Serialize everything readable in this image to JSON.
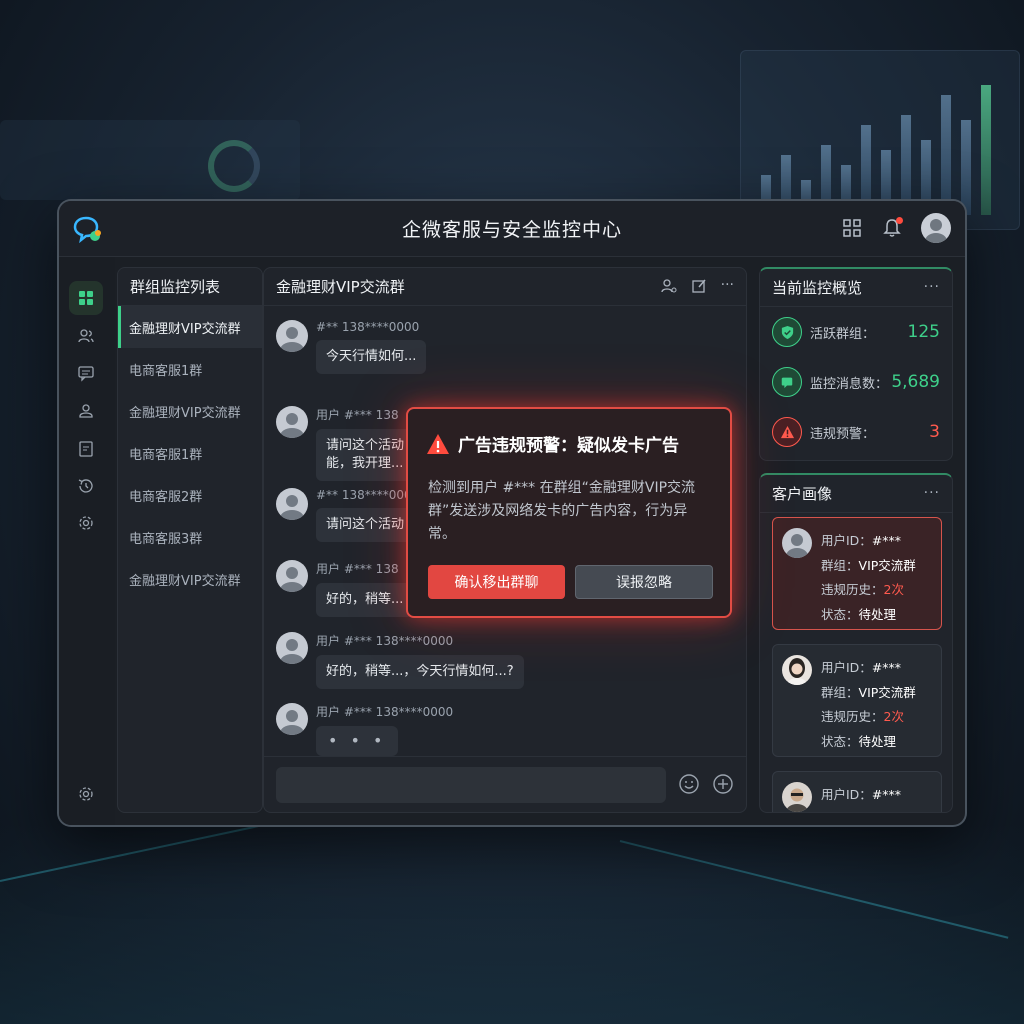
{
  "app": {
    "title": "企微客服与安全监控中心"
  },
  "groups": {
    "title": "群组监控列表",
    "items": [
      "金融理财VIP交流群",
      "电商客服1群",
      "金融理财VIP交流群",
      "电商客服1群",
      "电商客服2群",
      "电商客服3群",
      "金融理财VIP交流群"
    ]
  },
  "chat": {
    "title": "金融理财VIP交流群",
    "messages": [
      {
        "sender": "#** 138****0000",
        "text": "今天行情如何..."
      },
      {
        "sender": "用户 #*** 138",
        "text": "请问这个活动",
        "text2": "能，我开理..."
      },
      {
        "sender": "#** 138****000",
        "text": "请问这个活动"
      },
      {
        "sender": "用户 #*** 138",
        "text": "好的，稍等..."
      },
      {
        "sender": "用户 #*** 138****0000",
        "text": "好的，稍等...，今天行情如何...?"
      },
      {
        "sender": "用户 #*** 138****0000",
        "text": "• • •"
      }
    ],
    "input_placeholder": ""
  },
  "modal": {
    "title": "广告违规预警：疑似发卡广告",
    "body": "检测到用户 #*** 在群组“金融理财VIP交流群”发送涉及网络发卡的广告内容，行为异常。",
    "confirm_label": "确认移出群聊",
    "ignore_label": "误报忽略"
  },
  "overview": {
    "title": "当前监控概览",
    "more": "···",
    "rows": [
      {
        "label": "活跃群组：",
        "value": "125",
        "color": "#3ed08a"
      },
      {
        "label": "监控消息数：",
        "value": "5,689",
        "color": "#3ed08a"
      },
      {
        "label": "违规预警：",
        "value": "3",
        "color": "#ff5a4e"
      }
    ]
  },
  "portrait": {
    "title": "客户画像",
    "more": "···",
    "cards": [
      {
        "user": "用户ID：",
        "user_v": "#***",
        "group": "群组：",
        "group_v": "VIP交流群",
        "history": "违规历史：",
        "history_v": "2次",
        "status": "状态：",
        "status_v": "待处理"
      },
      {
        "user": "用户ID：",
        "user_v": "#***",
        "group": "群组：",
        "group_v": "VIP交流群",
        "history": "违规历史：",
        "history_v": "2次",
        "status": "状态：",
        "status_v": "待处理"
      },
      {
        "user": "用户ID：",
        "user_v": "#***"
      }
    ]
  },
  "colors": {
    "accent": "#3ed08a",
    "danger": "#e24741",
    "bg": "#1b1f25"
  }
}
